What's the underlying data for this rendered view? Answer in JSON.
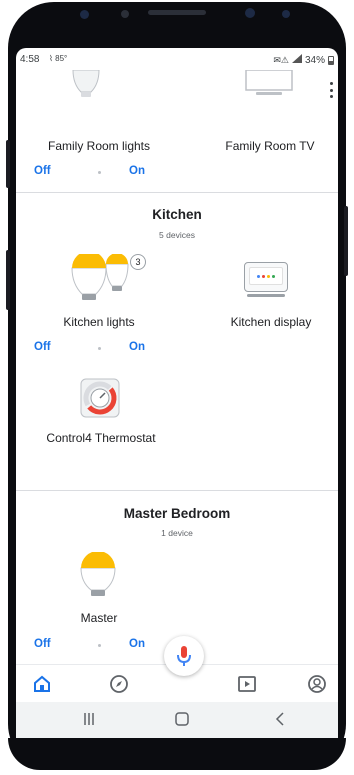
{
  "status_bar": {
    "time": "4:58",
    "temperature": "85°",
    "battery_text": "34%"
  },
  "top_row": {
    "left_device": {
      "label": "Family Room lights",
      "off_label": "Off",
      "on_label": "On"
    },
    "right_device": {
      "label": "Family Room TV"
    }
  },
  "kitchen": {
    "title": "Kitchen",
    "subtitle": "5 devices",
    "lights": {
      "label": "Kitchen lights",
      "badge": "3",
      "off_label": "Off",
      "on_label": "On"
    },
    "display": {
      "label": "Kitchen display"
    },
    "thermostat": {
      "label": "Control4 Thermostat"
    }
  },
  "master_bedroom": {
    "title": "Master Bedroom",
    "subtitle": "1 device",
    "light": {
      "label": "Master",
      "off_label": "Off",
      "on_label": "On"
    }
  },
  "colors": {
    "accent": "#1a73e8",
    "bulb_yellow": "#fbbc04",
    "mic_red": "#ea4335",
    "mic_blue": "#4285f4"
  },
  "icons": {
    "bottom_nav": [
      "home-icon",
      "discover-icon",
      "media-icon",
      "account-icon"
    ],
    "system_nav": [
      "recents-icon",
      "home-button-icon",
      "back-icon"
    ]
  }
}
